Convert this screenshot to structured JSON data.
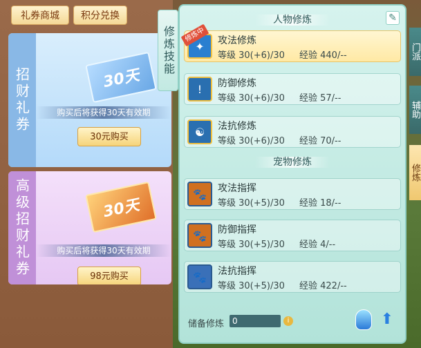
{
  "shop": {
    "tabs": [
      "礼券商城",
      "积分兑换"
    ],
    "cards": [
      {
        "side_label": "招财礼券",
        "ticket_text": "30天",
        "desc": "购买后将获得30天有效期",
        "buy_label": "30元购买",
        "color": "#89b8e6"
      },
      {
        "side_label": "高级招财礼券",
        "ticket_text": "30天",
        "desc": "购买后将获得30天有效期",
        "buy_label": "98元购买",
        "color": "#c090d8"
      }
    ]
  },
  "vertical_title": "修炼技能",
  "panel": {
    "sections": [
      {
        "title": "人物修炼",
        "items": [
          {
            "name": "攻法修炼",
            "level": "等级  30(+6)/30",
            "exp": "经验  440/--",
            "active": true,
            "badge": "修炼中",
            "icon": "attack-magic-icon",
            "color": "#2a7fd0"
          },
          {
            "name": "防御修炼",
            "level": "等级  30(+6)/30",
            "exp": "经验  57/--",
            "active": false,
            "icon": "defense-shield-icon",
            "color": "#2a6fb0"
          },
          {
            "name": "法抗修炼",
            "level": "等级  30(+6)/30",
            "exp": "经验  70/--",
            "active": false,
            "icon": "yin-yang-shield-icon",
            "color": "#2a6fb0"
          }
        ]
      },
      {
        "title": "宠物修炼",
        "items": [
          {
            "name": "攻法指挥",
            "level": "等级  30(+5)/30",
            "exp": "经验  18/--",
            "icon": "paw-attack-icon",
            "color": "#d07020"
          },
          {
            "name": "防御指挥",
            "level": "等级  30(+5)/30",
            "exp": "经验  4/--",
            "icon": "paw-defense-icon",
            "color": "#d07020"
          },
          {
            "name": "法抗指挥",
            "level": "等级  30(+5)/30",
            "exp": "经验  422/--",
            "icon": "paw-resist-icon",
            "color": "#3a70b8"
          }
        ]
      }
    ],
    "reserve_label": "储备修炼",
    "reserve_value": "0"
  },
  "right_tabs": [
    "门派",
    "辅助",
    "修炼"
  ]
}
